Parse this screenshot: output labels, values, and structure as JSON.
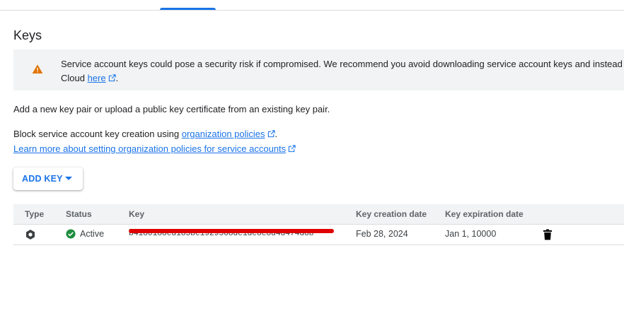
{
  "colors": {
    "accent": "#1a73e8",
    "warning": "#e37400",
    "active_status": "#1e8e3e",
    "redaction": "#e00000"
  },
  "page": {
    "title": "Keys"
  },
  "warning": {
    "icon": "warning-icon",
    "text_before_link": "Service account keys could pose a security risk if compromised. We recommend you avoid downloading service account keys and instead",
    "text_line2": "Cloud ",
    "link_text": "here",
    "text_after_link": "."
  },
  "intro_text": "Add a new key pair or upload a public key certificate from an existing key pair.",
  "org_policy": {
    "prefix": "Block service account key creation using ",
    "link_text": "organization policies",
    "suffix": ".",
    "learn_more": "Learn more about setting organization policies for service accounts"
  },
  "add_key_button": {
    "label": "ADD KEY"
  },
  "table": {
    "headers": [
      "Type",
      "Status",
      "Key",
      "Key creation date",
      "Key expiration date"
    ],
    "rows": [
      {
        "type_icon": "key-type-icon",
        "status": "Active",
        "key": "b4180188ed185be1929568de1de8e8d4d474d8b",
        "created": "Feb 28, 2024",
        "expires": "Jan 1, 10000",
        "action_icon": "delete-icon"
      }
    ]
  }
}
